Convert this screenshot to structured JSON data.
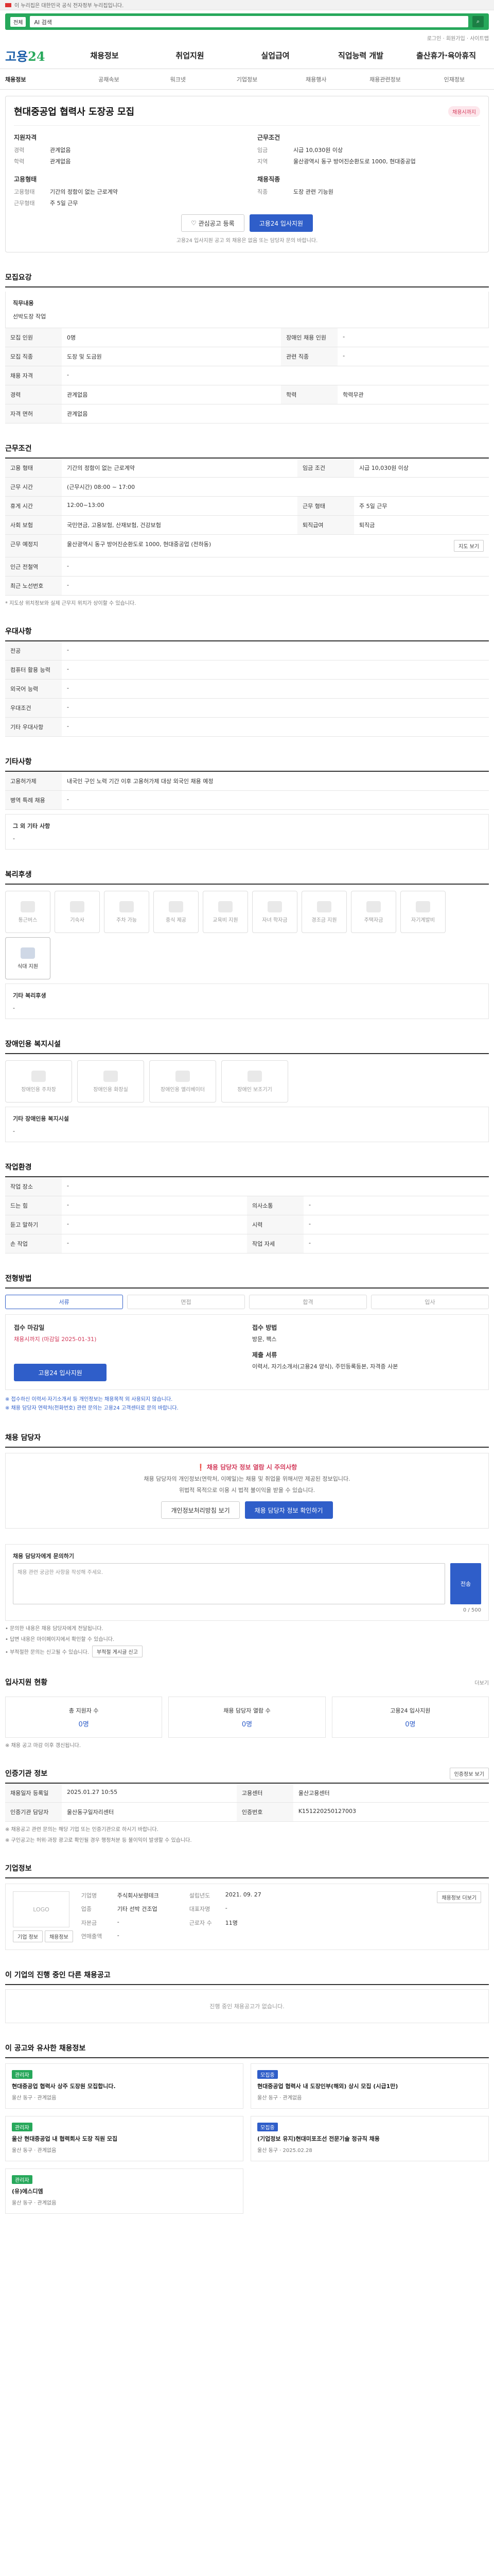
{
  "gov_banner": "이 누리집은 대한민국 공식 전자정부 누리집입니다.",
  "top_search": {
    "selector": "전체",
    "placeholder": "AI 검색",
    "brand": "고용24"
  },
  "utility": "로그인 · 회원가입 · 사이트맵",
  "nav": {
    "logo_main": "고용",
    "logo_num": "24",
    "items": [
      "채용정보",
      "취업지원",
      "실업급여",
      "직업능력 개발",
      "출산휴가·육아휴직"
    ]
  },
  "subnav": [
    "채용정보",
    "공채속보",
    "워크넷",
    "기업정보",
    "채용행사",
    "채용관련정보",
    "인재정보"
  ],
  "job": {
    "title": "현대중공업 협력사 도장공 모집",
    "badge": "채용시까지",
    "left_head": "지원자격",
    "left": [
      {
        "k": "경력",
        "v": "관계없음"
      },
      {
        "k": "학력",
        "v": "관계없음"
      }
    ],
    "right_head": "근무조건",
    "right": [
      {
        "k": "임금",
        "v": "시급 10,030원 이상"
      },
      {
        "k": "지역",
        "v": "울산광역시 동구 방어진순환도로 1000, 현대중공업"
      }
    ],
    "left2_head": "고용형태",
    "left2": [
      {
        "k": "고용형태",
        "v": "기간의 정함이 없는 근로계약"
      },
      {
        "k": "근무형태",
        "v": "주 5일 근무"
      }
    ],
    "right2_head": "채용직종",
    "right2": [
      {
        "k": "직종",
        "v": "도장 관련 기능원"
      }
    ],
    "btn_interest": "관심공고 등록",
    "btn_apply": "고용24 입사지원",
    "note": "고용24 입사지원 공고 외 채용은 없음 또는 담당자 문의 바랍니다."
  },
  "recruit": {
    "title": "모집요강",
    "duty_head": "직무내용",
    "duty": "선박도장 작업",
    "rows": [
      {
        "k1": "모집 인원",
        "v1": "0명",
        "k2": "장애인 채용 인원",
        "v2": "-"
      },
      {
        "k1": "모집 직종",
        "v1": "도장 및 도금원",
        "k2": "관련 직종",
        "v2": "-"
      },
      {
        "k1": "채용 자격",
        "v1": "-",
        "k2": "",
        "v2": ""
      },
      {
        "k1": "경력",
        "v1": "관계없음",
        "k2": "학력",
        "v2": "학력무관"
      },
      {
        "k1": "자격 면허",
        "v1": "관계없음",
        "k2": "",
        "v2": ""
      }
    ]
  },
  "conditions": {
    "title": "근무조건",
    "rows": [
      {
        "k1": "고용 형태",
        "v1": "기간의 정함이 없는 근로계약",
        "k2": "임금 조건",
        "v2": "시급 10,030원 이상"
      },
      {
        "k1": "근무 시간",
        "v1": "(근무시간) 08:00 ~ 17:00",
        "k2": "",
        "v2": ""
      },
      {
        "k1": "휴게 시간",
        "v1": "12:00~13:00",
        "k2": "근무 형태",
        "v2": "주 5일 근무"
      },
      {
        "k1": "사회 보험",
        "v1": "국민연금, 고용보험, 산재보험, 건강보험",
        "k2": "퇴직급여",
        "v2": "퇴직금"
      },
      {
        "k1": "근무 예정지",
        "v1": "울산광역시 동구 방어진순환도로 1000, 현대중공업 (전하동)",
        "k2": "",
        "v2": ""
      },
      {
        "k1": "인근 전철역",
        "v1": "-",
        "k2": "",
        "v2": ""
      },
      {
        "k1": "최근 노선번호",
        "v1": "-",
        "k2": "",
        "v2": ""
      }
    ],
    "map_btn": "지도 보기",
    "footnote": "* 지도상 위치정보와 실제 근무지 위치가 상이할 수 있습니다."
  },
  "pref": {
    "title": "우대사항",
    "rows": [
      {
        "k": "전공",
        "v": "-"
      },
      {
        "k": "컴퓨터 활용 능력",
        "v": "-"
      },
      {
        "k": "외국어 능력",
        "v": "-"
      },
      {
        "k": "우대조건",
        "v": "-"
      },
      {
        "k": "기타 우대사항",
        "v": "-"
      }
    ]
  },
  "etc": {
    "title": "기타사항",
    "rows": [
      {
        "k": "고용허가제",
        "v": "내국인 구인 노력 기간 이후 고용허가제 대상 외국인 채용 예정"
      },
      {
        "k": "병역 특례 채용",
        "v": "-"
      }
    ],
    "box_head": "그 외 기타 사항",
    "box_text": "-"
  },
  "welfare": {
    "title": "복리후생",
    "items": [
      {
        "label": "통근버스",
        "on": false
      },
      {
        "label": "기숙사",
        "on": false
      },
      {
        "label": "주차 가능",
        "on": false
      },
      {
        "label": "중식 제공",
        "on": false
      },
      {
        "label": "교육비 지원",
        "on": false
      },
      {
        "label": "자녀 학자금",
        "on": false
      },
      {
        "label": "경조금 지원",
        "on": false
      },
      {
        "label": "주택자금",
        "on": false
      },
      {
        "label": "자기계발비",
        "on": false
      },
      {
        "label": "식대 지원",
        "on": true
      }
    ],
    "etc_head": "기타 복리후생",
    "etc_val": "-"
  },
  "disab": {
    "title": "장애인용 복지시설",
    "items": [
      "장애인용 주차장",
      "장애인용 화장실",
      "장애인용 엘리베이터",
      "장애인 보조기기"
    ],
    "etc_head": "기타 장애인용 복지시설",
    "etc_val": "-"
  },
  "worklevel": {
    "title": "작업환경",
    "rows": [
      {
        "k1": "작업 장소",
        "v1": "-",
        "k2": "",
        "v2": ""
      },
      {
        "k1": "드는 힘",
        "v1": "-",
        "k2": "의사소통",
        "v2": "-"
      },
      {
        "k1": "듣고 말하기",
        "v1": "-",
        "k2": "시력",
        "v2": "-"
      },
      {
        "k1": "손 작업",
        "v1": "-",
        "k2": "작업 자세",
        "v2": "-"
      }
    ]
  },
  "process": {
    "title": "전형방법",
    "steps": [
      "서류",
      "면접",
      "합격",
      "입사"
    ],
    "apply_head": "접수 마감일",
    "apply_date": "채용시까지 (마감일 2025-01-31)",
    "method_head": "접수 방법",
    "method": "방문, 팩스",
    "docs_head": "제출 서류",
    "docs": "이력서, 자기소개서(고용24 양식), 주민등록등본, 자격증 사본",
    "apply_btn": "고용24 입사지원",
    "warn1": "※ 접수하신 이력서·자기소개서 등 개인정보는 채용목적 외 사용되지 않습니다.",
    "warn2": "※ 채용 담당자 연락처(전화번호) 관련 문의는 고용24 고객센터로 문의 바랍니다."
  },
  "contact": {
    "title": "채용 담당자",
    "alert": "채용 담당자 정보 열람 시 주의사항",
    "p1": "채용 담당자의 개인정보(연락처, 이메일)는 채용 및 취업을 위해서만 제공된 정보입니다.",
    "p2": "위법적 목적으로 이용 시 법적 불이익을 받을 수 있습니다.",
    "btn1": "개인정보처리방침 보기",
    "btn2": "채용 담당자 정보 확인하기"
  },
  "inquiry": {
    "title": "채용 담당자에게 문의하기",
    "placeholder": "채용 관련 궁금한 사항을 작성해 주세요.",
    "counter": "0 / 500",
    "submit": "전송",
    "notes": [
      "• 문의한 내용은 채용 담당자에게 전달됩니다.",
      "• 답변 내용은 마이페이지에서 확인할 수 있습니다.",
      "• 부적절한 문의는 신고될 수 있습니다."
    ],
    "report": "부적절 게시글 신고"
  },
  "status": {
    "title": "입사지원 현황",
    "more": "더보기",
    "cards": [
      {
        "label": "총 지원자 수",
        "val": "0명"
      },
      {
        "label": "채용 담당자 열람 수",
        "val": "0명"
      },
      {
        "label": "고용24 입사지원",
        "val": "0명"
      }
    ],
    "note": "※ 채용 공고 마감 이후 갱신됩니다."
  },
  "agency": {
    "title": "인증기관 정보",
    "btn": "인증정보 보기",
    "rows": [
      {
        "k1": "채용일자 등록일",
        "v1": "2025.01.27 10:55",
        "k2": "고용센터",
        "v2": "울산고용센터"
      },
      {
        "k1": "인증기관 담당자",
        "v1": "울산동구일자리센터",
        "k2": "인증번호",
        "v2": "K151220250127003"
      }
    ],
    "notes": [
      "※ 채용공고 관련 문의는 해당 기업 또는 인증기관으로 하시기 바랍니다.",
      "※ 구인공고는 허위·과장 광고로 확인될 경우 행정처분 등 불이익이 발생할 수 있습니다."
    ]
  },
  "company": {
    "title": "기업정보",
    "logo": "LOGO",
    "btn_a": "기업 정보",
    "btn_b": "채용정보",
    "rows": [
      {
        "k1": "기업명",
        "v1": "주식회사보령테크",
        "k2": "설립년도",
        "v2": "2021. 09. 27"
      },
      {
        "k1": "업종",
        "v1": "기타 선박 건조업",
        "k2": "대표자명",
        "v2": "-"
      },
      {
        "k1": "자본금",
        "v1": "-",
        "k2": "근로자 수",
        "v2": "11명"
      },
      {
        "k1": "연매출액",
        "v1": "-",
        "k2": "",
        "v2": ""
      }
    ],
    "follow": "채용정보 더보기"
  },
  "others": {
    "title": "이 기업의 진행 중인 다른 채용공고",
    "empty": "진행 중인 채용공고가 없습니다."
  },
  "recommend": {
    "title": "이 공고와 유사한 채용정보",
    "items": [
      {
        "tag": "관리자",
        "tag_color": "#27a85b",
        "title": "현대중공업 협력사 상주 도장원 모집합니다.",
        "meta": "울산 동구 · 관계없음"
      },
      {
        "tag": "모집중",
        "tag_color": "#2f5ec9",
        "title": "현대중공업 협력사 내 도장인부(해외) 상시 모집 (시급1만)",
        "meta": "울산 동구 · 관계없음"
      },
      {
        "tag": "관리자",
        "tag_color": "#27a85b",
        "title": "울산 현대중공업 내 협력회사 도장 직원 모집",
        "meta": "울산 동구 · 관계없음"
      },
      {
        "tag": "모집중",
        "tag_color": "#2f5ec9",
        "title": "(기업정보 유지)현대미포조선 전문기술 정규직 채용",
        "meta": "울산 동구 · 2025.02.28"
      },
      {
        "tag": "관리자",
        "tag_color": "#27a85b",
        "title": "(유)에스디엠",
        "meta": "울산 동구 · 관계없음"
      }
    ]
  }
}
